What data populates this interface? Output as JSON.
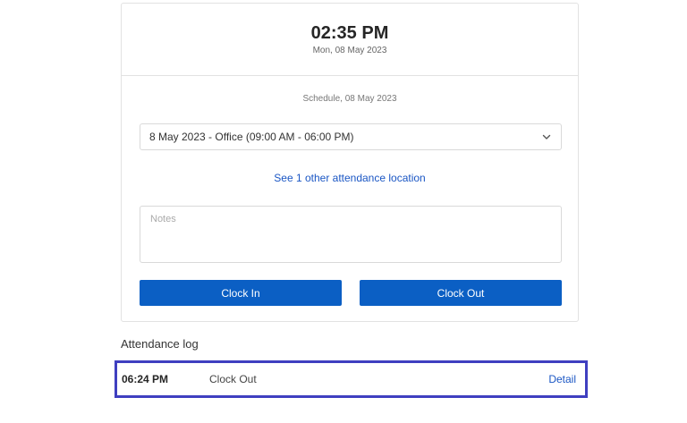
{
  "clock": {
    "time": "02:35 PM",
    "date": "Mon, 08 May 2023"
  },
  "schedule": {
    "label": "Schedule, 08 May 2023",
    "selected": "8 May 2023 - Office (09:00 AM - 06:00 PM)",
    "other_locations_link": "See 1 other attendance location"
  },
  "notes": {
    "placeholder": "Notes",
    "value": ""
  },
  "actions": {
    "clock_in": "Clock In",
    "clock_out": "Clock Out"
  },
  "attendance_log": {
    "title": "Attendance log",
    "entries": [
      {
        "time": "06:24 PM",
        "action": "Clock Out",
        "detail_label": "Detail"
      }
    ]
  },
  "colors": {
    "primary": "#0b5fc4",
    "link": "#1a56c4",
    "highlight_border": "#3f3fc0"
  }
}
